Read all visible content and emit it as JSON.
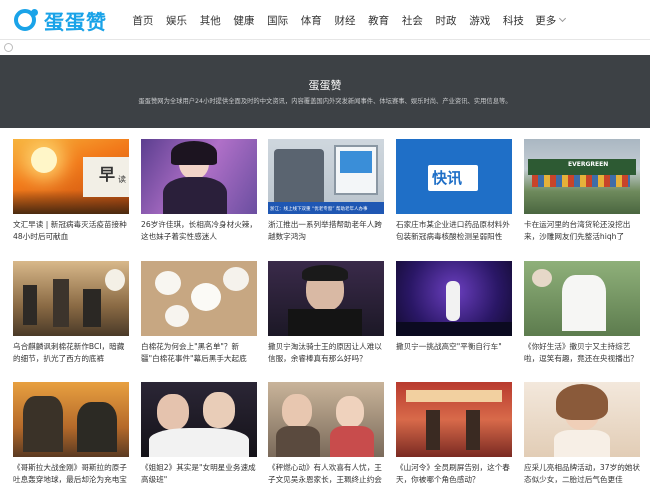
{
  "brand": {
    "name": "蛋蛋赞"
  },
  "nav": {
    "items": [
      "首页",
      "娱乐",
      "其他",
      "健康",
      "国际",
      "体育",
      "财经",
      "教育",
      "社会",
      "时政",
      "游戏",
      "科技"
    ],
    "more": "更多"
  },
  "banner": {
    "title": "蛋蛋赞",
    "description": "蛋蛋赞网为全球用户24小时提供全面及时的中文资讯，内容覆盖国内外突发新闻事件、体坛赛事、娱乐时尚、产业资讯、实用信息等。"
  },
  "thumb_text": {
    "zao": "早",
    "du": "读",
    "kuaixun": "快讯",
    "ship_name": "EVERGREEN",
    "caption_bar": "浙江：线上线下双重 “优老专窗” 帮助老年人办事"
  },
  "articles": [
    {
      "title": "文汇早读 | 新冠病毒灭活疫苗接种48小时后可献血"
    },
    {
      "title": "26岁许佳琪，长相高冷身材火辣，这也妹子着实性感迷人"
    },
    {
      "title": "浙江推出一系列举措帮助老年人跨越数字鸿沟"
    },
    {
      "title": "石家庄市某企业进口药品原材料外包装新冠病毒核酸检测呈弱阳性"
    },
    {
      "title": "卡在运河里的台湾货轮还没挖出来，沙雕网友们先整活hiqh了"
    },
    {
      "title": "乌合麒麟讽刺棉花新作BCI，暗藏的细节，扒光了西方的底裤"
    },
    {
      "title": "白棉花为何会上\"黑名单\"？新疆\"白棉花事件\"幕后黑手大起底"
    },
    {
      "title": "撒贝宁淘汰骑士王的原因让人难以信服，余睿棒真有那么好吗？"
    },
    {
      "title": "撒贝宁一挑战高空\"平衡自行车\""
    },
    {
      "title": "《你好生活》撒贝宁又主持综艺啦，逗笑有趣，竟还在央视播出？"
    },
    {
      "title": "《哥斯拉大战金刚》哥斯拉的原子吐息轰穿地球，最后却沦为充电宝"
    },
    {
      "title": "《姐姐2》其实是\"女明星业务速成高级班\""
    },
    {
      "title": "《秤燃心动》有人欢喜有人忧，王子文见吴永恩家长，王珮终止约会"
    },
    {
      "title": "《山河令》全员刷屏告别，这个春天，你被哪个角色感动？"
    },
    {
      "title": "应采儿亮相品牌活动，37岁的她状态似少女，二胎过后气色更佳"
    }
  ]
}
